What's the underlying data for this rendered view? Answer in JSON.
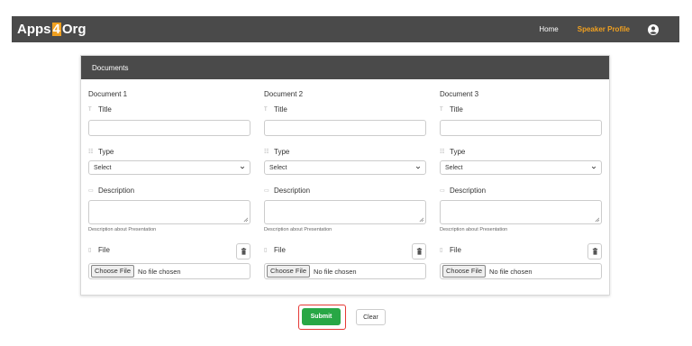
{
  "app": {
    "brand_prefix": "Apps",
    "brand_four": "4",
    "brand_suffix": "Org"
  },
  "nav": {
    "home": "Home",
    "speaker_profile": "Speaker Profile",
    "active_color": "#f0a020",
    "user_icon": "user-circle-icon"
  },
  "card": {
    "header": "Documents"
  },
  "documents": [
    {
      "heading": "Document 1",
      "title_label": "Title",
      "title_value": "",
      "type_label": "Type",
      "type_selected": "Select",
      "description_label": "Description",
      "description_value": "",
      "description_hint": "Description about Presentation",
      "file_label": "File",
      "choose_button": "Choose File",
      "file_status": "No file chosen"
    },
    {
      "heading": "Document 2",
      "title_label": "Title",
      "title_value": "",
      "type_label": "Type",
      "type_selected": "Select",
      "description_label": "Description",
      "description_value": "",
      "description_hint": "Description about Presentation",
      "file_label": "File",
      "choose_button": "Choose File",
      "file_status": "No file chosen"
    },
    {
      "heading": "Document 3",
      "title_label": "Title",
      "title_value": "",
      "type_label": "Type",
      "type_selected": "Select",
      "description_label": "Description",
      "description_value": "",
      "description_hint": "Description about Presentation",
      "file_label": "File",
      "choose_button": "Choose File",
      "file_status": "No file chosen"
    }
  ],
  "actions": {
    "submit": "Submit",
    "clear": "Clear",
    "submit_color": "#28a745",
    "highlight_color": "#e53935"
  }
}
